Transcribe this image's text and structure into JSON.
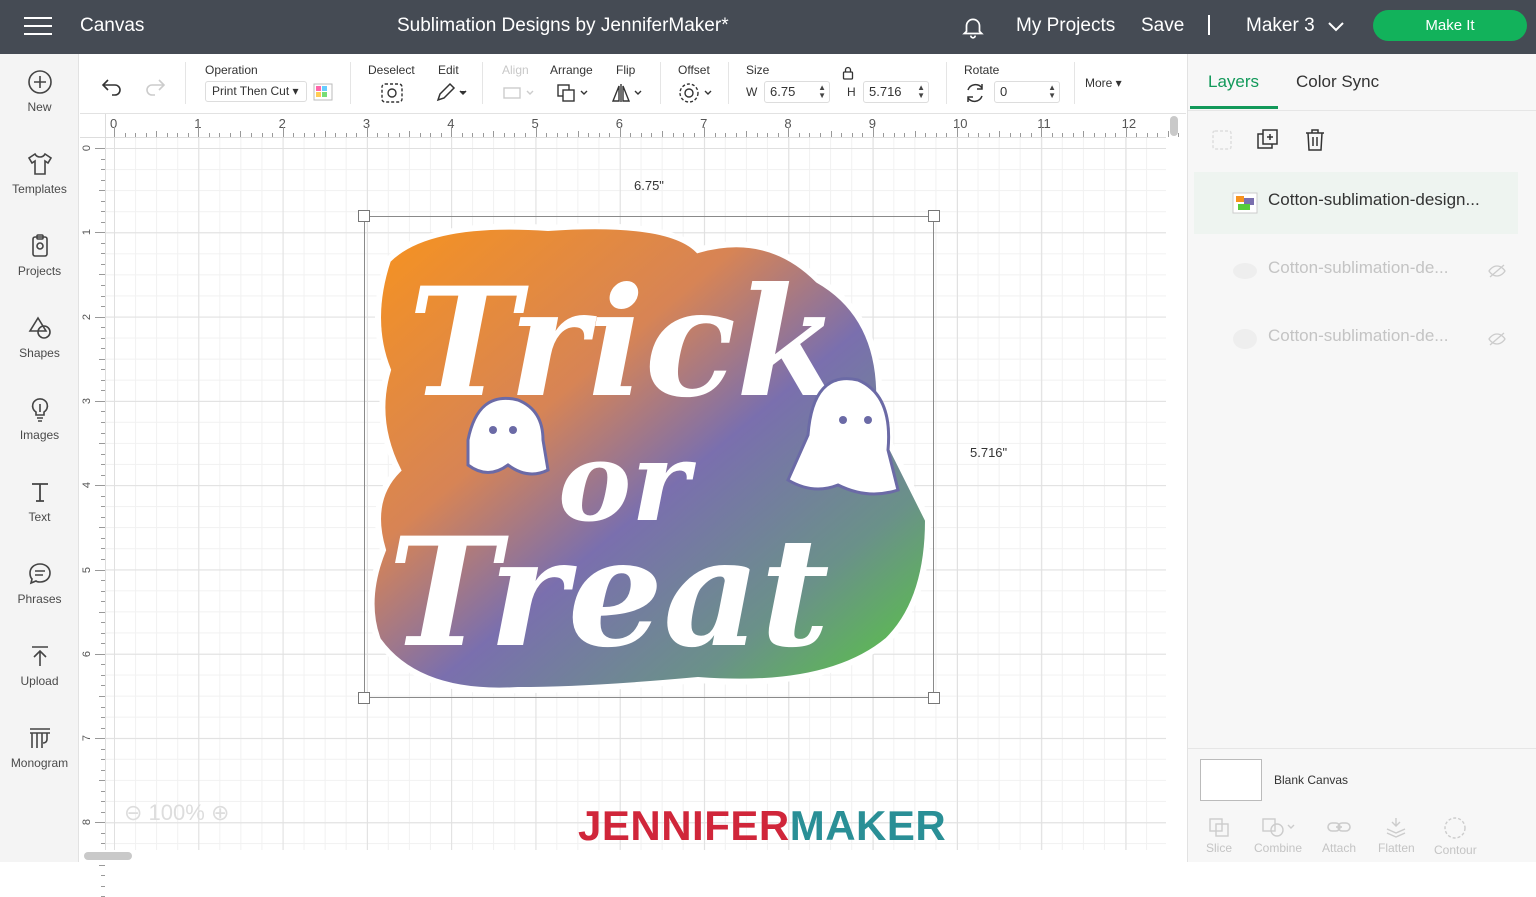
{
  "header": {
    "app_title": "Canvas",
    "doc_title": "Sublimation Designs by JenniferMaker*",
    "my_projects": "My Projects",
    "save": "Save",
    "machine": "Maker 3",
    "make_it": "Make It",
    "make_it_color": "#12b25b",
    "bg_color": "#454b54"
  },
  "leftnav": {
    "items": [
      {
        "label": "New",
        "icon": "plus-circle-icon"
      },
      {
        "label": "Templates",
        "icon": "tshirt-icon"
      },
      {
        "label": "Projects",
        "icon": "clipboard-icon"
      },
      {
        "label": "Shapes",
        "icon": "shapes-icon"
      },
      {
        "label": "Images",
        "icon": "lightbulb-icon"
      },
      {
        "label": "Text",
        "icon": "text-t-icon"
      },
      {
        "label": "Phrases",
        "icon": "speech-bubble-icon"
      },
      {
        "label": "Upload",
        "icon": "upload-arrow-icon"
      },
      {
        "label": "Monogram",
        "icon": "monogram-icon"
      }
    ]
  },
  "toolbar": {
    "operation_label": "Operation",
    "operation_value": "Print Then Cut",
    "deselect": "Deselect",
    "edit": "Edit",
    "align": "Align",
    "arrange": "Arrange",
    "flip": "Flip",
    "offset": "Offset",
    "size": "Size",
    "w_label": "W",
    "w_value": "6.75",
    "h_label": "H",
    "h_value": "5.716",
    "rotate": "Rotate",
    "rotate_value": "0",
    "more": "More"
  },
  "ruler": {
    "top": [
      "0",
      "1",
      "2",
      "3",
      "4",
      "5",
      "6",
      "7",
      "8",
      "9",
      "10",
      "11",
      "12"
    ],
    "left": [
      "0",
      "1",
      "2",
      "3",
      "4",
      "5",
      "6",
      "7",
      "8"
    ]
  },
  "canvas": {
    "width_dim": "6.75\"",
    "height_dim": "5.716\"",
    "design_text_line1": "Trick",
    "design_text_line2": "or",
    "design_text_line3": "Treat",
    "zoom": "100%"
  },
  "rightpanel": {
    "tab_layers": "Layers",
    "tab_colorsync": "Color Sync",
    "layers": [
      {
        "name": "Cotton-sublimation-design...",
        "visible": true
      },
      {
        "name": "Cotton-sublimation-de...",
        "visible": false
      },
      {
        "name": "Cotton-sublimation-de...",
        "visible": false
      }
    ],
    "blank_canvas": "Blank Canvas",
    "tools": [
      "Slice",
      "Combine",
      "Attach",
      "Flatten",
      "Contour"
    ]
  },
  "branding": {
    "part1": "JENNIFER",
    "part2": "MAKER",
    "color1": "#d0263a",
    "color2": "#2a8f96"
  }
}
